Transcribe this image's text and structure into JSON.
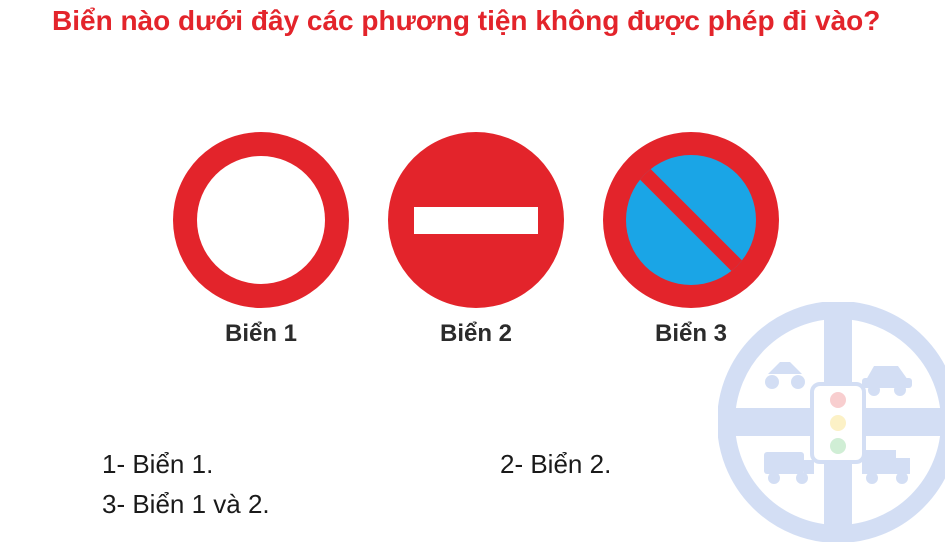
{
  "question": "Biển nào dưới đây các phương tiện không được phép đi vào?",
  "signs": [
    {
      "label": "Biển 1",
      "icon": "no-vehicles-sign-icon"
    },
    {
      "label": "Biển 2",
      "icon": "no-entry-sign-icon"
    },
    {
      "label": "Biển 3",
      "icon": "no-parking-sign-icon"
    }
  ],
  "answers": [
    {
      "text": "1- Biển 1."
    },
    {
      "text": "2- Biển 2."
    },
    {
      "text": "3- Biển 1 và 2."
    }
  ],
  "colors": {
    "question_text": "#e3242b",
    "sign_red": "#e3242b",
    "sign_blue": "#1aa5e6",
    "watermark": "#3b6fd1"
  },
  "watermark_icon": "steering-wheel-logo-icon"
}
